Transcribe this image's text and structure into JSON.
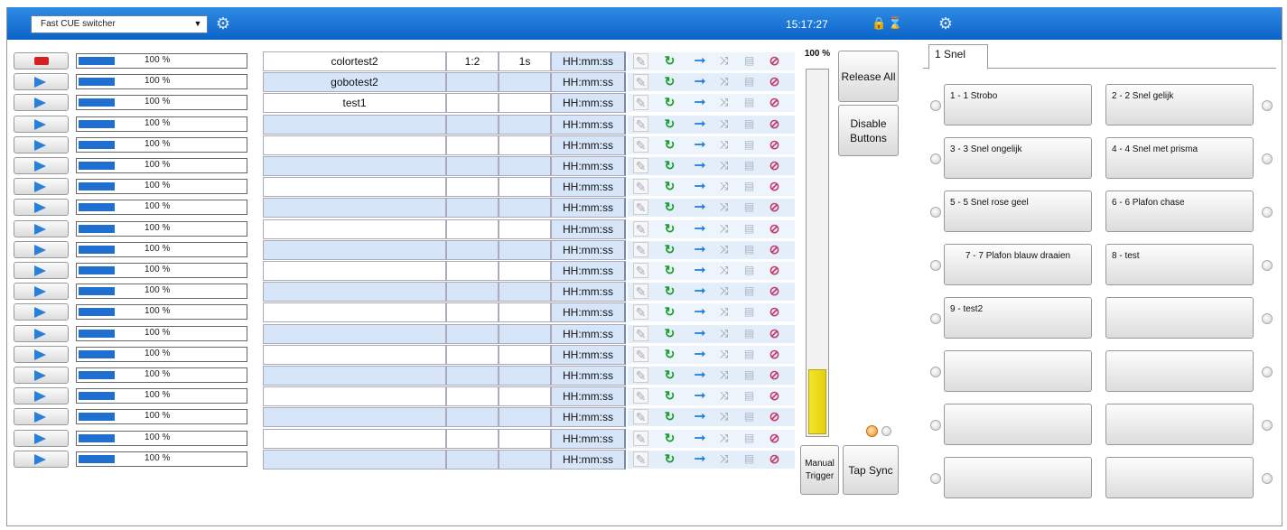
{
  "titlebar": {
    "combo_value": "Fast CUE switcher",
    "clock": "15:17:27"
  },
  "cue_rows": [
    {
      "state": "stop",
      "level": "100 %",
      "level_fraction": 1.0,
      "name": "colortest2",
      "ratio": "1:2",
      "fade": "1s",
      "time": "HH:mm:ss"
    },
    {
      "state": "play",
      "level": "100 %",
      "level_fraction": 1.0,
      "name": "gobotest2",
      "ratio": "",
      "fade": "",
      "time": "HH:mm:ss"
    },
    {
      "state": "play",
      "level": "100 %",
      "level_fraction": 1.0,
      "name": "test1",
      "ratio": "",
      "fade": "",
      "time": "HH:mm:ss"
    },
    {
      "state": "play",
      "level": "100 %",
      "level_fraction": 1.0,
      "name": "",
      "ratio": "",
      "fade": "",
      "time": "HH:mm:ss"
    },
    {
      "state": "play",
      "level": "100 %",
      "level_fraction": 1.0,
      "name": "",
      "ratio": "",
      "fade": "",
      "time": "HH:mm:ss"
    },
    {
      "state": "play",
      "level": "100 %",
      "level_fraction": 1.0,
      "name": "",
      "ratio": "",
      "fade": "",
      "time": "HH:mm:ss"
    },
    {
      "state": "play",
      "level": "100 %",
      "level_fraction": 1.0,
      "name": "",
      "ratio": "",
      "fade": "",
      "time": "HH:mm:ss"
    },
    {
      "state": "play",
      "level": "100 %",
      "level_fraction": 1.0,
      "name": "",
      "ratio": "",
      "fade": "",
      "time": "HH:mm:ss"
    },
    {
      "state": "play",
      "level": "100 %",
      "level_fraction": 1.0,
      "name": "",
      "ratio": "",
      "fade": "",
      "time": "HH:mm:ss"
    },
    {
      "state": "play",
      "level": "100 %",
      "level_fraction": 1.0,
      "name": "",
      "ratio": "",
      "fade": "",
      "time": "HH:mm:ss"
    },
    {
      "state": "play",
      "level": "100 %",
      "level_fraction": 1.0,
      "name": "",
      "ratio": "",
      "fade": "",
      "time": "HH:mm:ss"
    },
    {
      "state": "play",
      "level": "100 %",
      "level_fraction": 1.0,
      "name": "",
      "ratio": "",
      "fade": "",
      "time": "HH:mm:ss"
    },
    {
      "state": "play",
      "level": "100 %",
      "level_fraction": 1.0,
      "name": "",
      "ratio": "",
      "fade": "",
      "time": "HH:mm:ss"
    },
    {
      "state": "play",
      "level": "100 %",
      "level_fraction": 1.0,
      "name": "",
      "ratio": "",
      "fade": "",
      "time": "HH:mm:ss"
    },
    {
      "state": "play",
      "level": "100 %",
      "level_fraction": 1.0,
      "name": "",
      "ratio": "",
      "fade": "",
      "time": "HH:mm:ss"
    },
    {
      "state": "play",
      "level": "100 %",
      "level_fraction": 1.0,
      "name": "",
      "ratio": "",
      "fade": "",
      "time": "HH:mm:ss"
    },
    {
      "state": "play",
      "level": "100 %",
      "level_fraction": 1.0,
      "name": "",
      "ratio": "",
      "fade": "",
      "time": "HH:mm:ss"
    },
    {
      "state": "play",
      "level": "100 %",
      "level_fraction": 1.0,
      "name": "",
      "ratio": "",
      "fade": "",
      "time": "HH:mm:ss"
    },
    {
      "state": "play",
      "level": "100 %",
      "level_fraction": 1.0,
      "name": "",
      "ratio": "",
      "fade": "",
      "time": "HH:mm:ss"
    },
    {
      "state": "play",
      "level": "100 %",
      "level_fraction": 1.0,
      "name": "",
      "ratio": "",
      "fade": "",
      "time": "HH:mm:ss"
    }
  ],
  "master": {
    "label": "100 %",
    "fill_fraction": 0.18
  },
  "buttons": {
    "release_all": "Release All",
    "disable_buttons": "Disable Buttons",
    "manual_trigger": "Manual Trigger",
    "tap_sync": "Tap Sync"
  },
  "panel": {
    "tab_label": "1 Snel",
    "cues": [
      "1 - 1 Strobo",
      "2 - 2 Snel gelijk",
      "3 - 3 Snel ongelijk",
      "4 - 4 Snel met prisma",
      "5 - 5 Snel rose geel",
      "6 - 6 Plafon chase",
      "7 - 7 Plafon blauw draaien",
      "8 - test",
      "9 - test2",
      "",
      "",
      "",
      "",
      "",
      "",
      ""
    ]
  },
  "colors": {
    "titlebar": "#1473d6",
    "row_alt": "#d6e6f8",
    "level_fill": "#1f6fd1",
    "master_fill": "#f3e42d"
  }
}
